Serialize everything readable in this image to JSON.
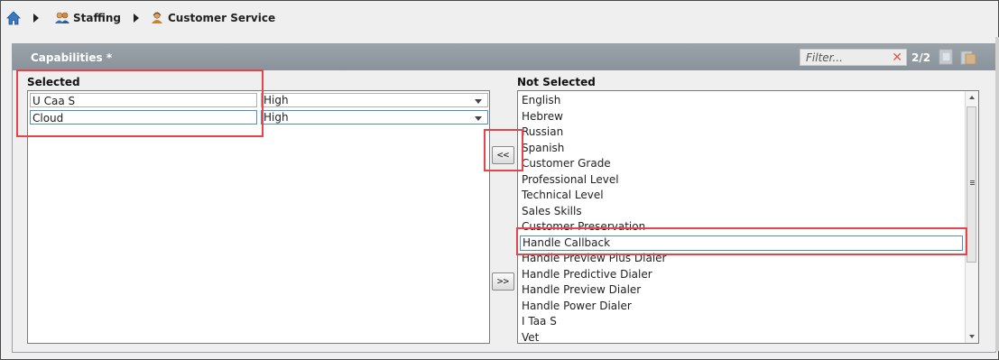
{
  "breadcrumb": {
    "items": [
      {
        "label": "Staffing",
        "icon": "people-icon"
      },
      {
        "label": "Customer Service",
        "icon": "agent-icon"
      }
    ]
  },
  "panel": {
    "title": "Capabilities *",
    "filter_placeholder": "Filter...",
    "count": "2/2"
  },
  "selected": {
    "label": "Selected",
    "rows": [
      {
        "name": "U Caa S",
        "level": "High"
      },
      {
        "name": "Cloud",
        "level": "High"
      }
    ]
  },
  "buttons": {
    "add": "<<",
    "remove": ">>"
  },
  "not_selected": {
    "label": "Not Selected",
    "items": [
      "English",
      "Hebrew",
      "Russian",
      "Spanish",
      "Customer Grade",
      "Professional Level",
      "Technical Level",
      "Sales Skills",
      "Customer Preservation",
      "Handle Callback",
      "Handle Preview Plus Dialer",
      "Handle Predictive Dialer",
      "Handle Preview Dialer",
      "Handle Power Dialer",
      "I Taa S",
      "Vet"
    ],
    "selected_item": "Handle Callback"
  },
  "colors": {
    "header": "#8f989f",
    "highlight": "#e4454a",
    "focus": "#4f8ec7"
  }
}
